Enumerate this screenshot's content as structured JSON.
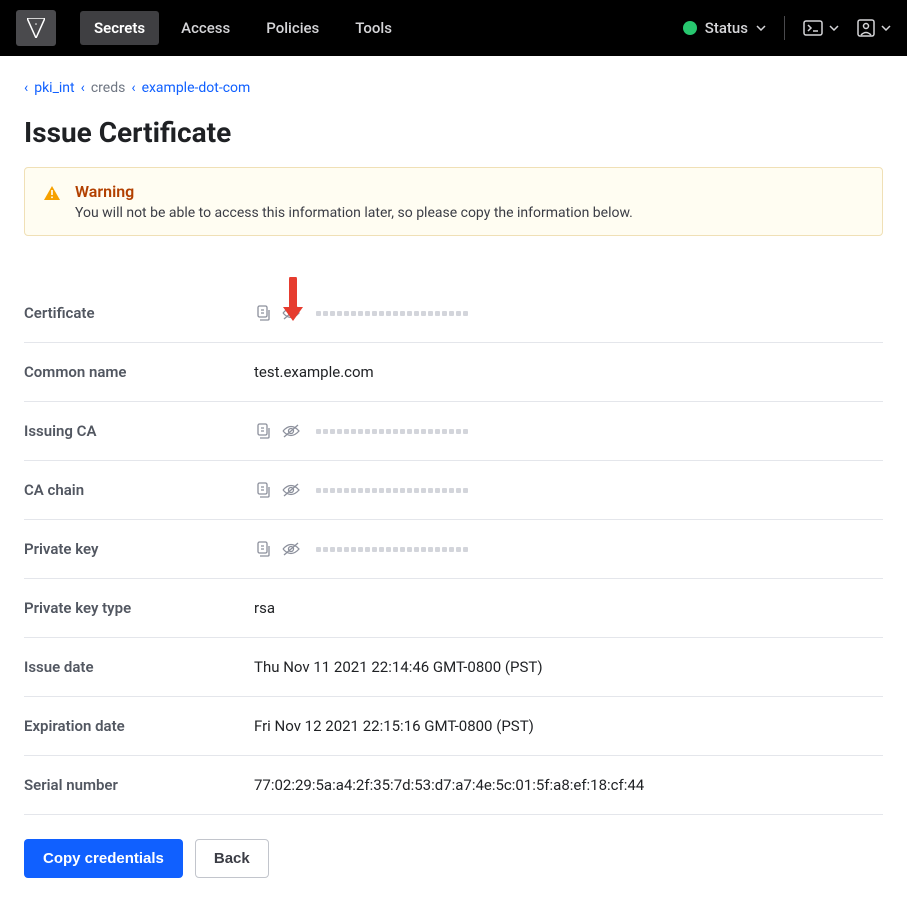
{
  "nav": {
    "items": [
      "Secrets",
      "Access",
      "Policies",
      "Tools"
    ],
    "status_label": "Status"
  },
  "breadcrumbs": {
    "items": [
      "pki_int",
      "creds",
      "example-dot-com"
    ]
  },
  "page": {
    "title": "Issue Certificate"
  },
  "alert": {
    "title": "Warning",
    "body": "You will not be able to access this information later, so please copy the information below."
  },
  "fields": {
    "certificate": {
      "label": "Certificate",
      "masked": true
    },
    "common_name": {
      "label": "Common name",
      "value": "test.example.com"
    },
    "issuing_ca": {
      "label": "Issuing CA",
      "masked": true
    },
    "ca_chain": {
      "label": "CA chain",
      "masked": true
    },
    "private_key": {
      "label": "Private key",
      "masked": true
    },
    "private_key_type": {
      "label": "Private key type",
      "value": "rsa"
    },
    "issue_date": {
      "label": "Issue date",
      "value": "Thu Nov 11 2021 22:14:46 GMT-0800 (PST)"
    },
    "expiration_date": {
      "label": "Expiration date",
      "value": "Fri Nov 12 2021 22:15:16 GMT-0800 (PST)"
    },
    "serial_number": {
      "label": "Serial number",
      "value": "77:02:29:5a:a4:2f:35:7d:53:d7:a7:4e:5c:01:5f:a8:ef:18:cf:44"
    }
  },
  "actions": {
    "copy": "Copy credentials",
    "back": "Back"
  }
}
